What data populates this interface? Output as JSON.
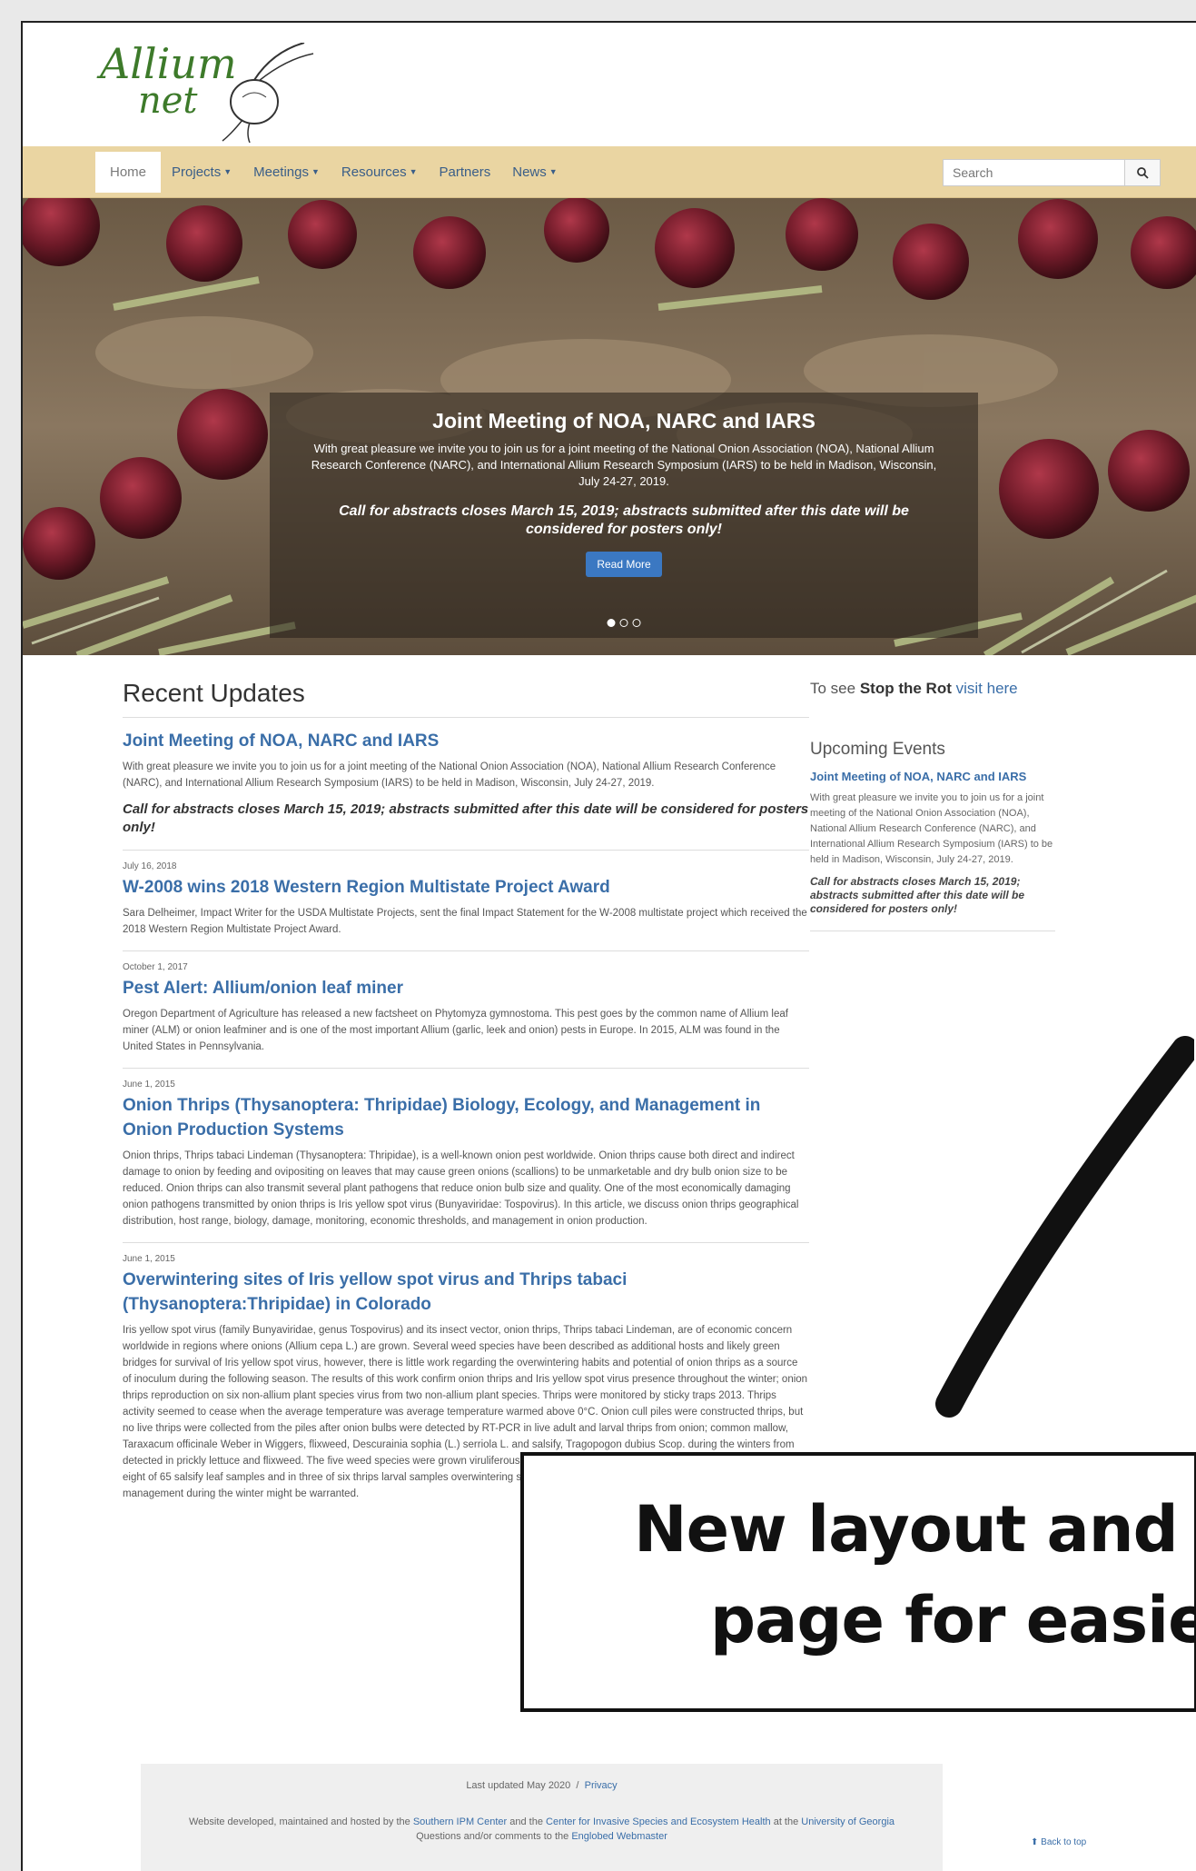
{
  "logo": {
    "line1": "Allium",
    "line2": "net"
  },
  "nav": {
    "items": [
      {
        "label": "Home"
      },
      {
        "label": "Projects"
      },
      {
        "label": "Meetings"
      },
      {
        "label": "Resources"
      },
      {
        "label": "Partners"
      },
      {
        "label": "News"
      }
    ],
    "search_placeholder": "Search"
  },
  "hero": {
    "title": "Joint Meeting of NOA, NARC and IARS",
    "text": "With great pleasure we invite you to join us for a joint meeting of the National Onion Association (NOA), National Allium Research Conference (NARC), and International Allium Research Symposium (IARS) to be held in Madison, Wisconsin, July 24-27, 2019.",
    "cta": "Call for abstracts closes March 15, 2019; abstracts submitted after this date will be considered for posters only!",
    "button": "Read More"
  },
  "recent": {
    "heading": "Recent Updates",
    "posts": [
      {
        "date": "",
        "title": "Joint Meeting of NOA, NARC and IARS",
        "body": "With great pleasure we invite you to join us for a joint meeting of the National Onion Association (NOA), National Allium Research Conference (NARC), and International Allium Research Symposium (IARS) to be held in Madison, Wisconsin, July 24-27, 2019.",
        "cta": "Call for abstracts closes March 15, 2019; abstracts submitted after this date will be considered for posters only!"
      },
      {
        "date": "July 16, 2018",
        "title": "W-2008 wins 2018 Western Region Multistate Project Award",
        "body": "Sara Delheimer, Impact Writer for the USDA Multistate Projects, sent the final Impact Statement for the W-2008 multistate project which received the 2018 Western Region Multistate Project Award.",
        "cta": ""
      },
      {
        "date": "October 1, 2017",
        "title": "Pest Alert: Allium/onion leaf miner",
        "body": "Oregon Department of Agriculture has released a new factsheet on Phytomyza gymnostoma. This pest goes by the common name of Allium leaf miner (ALM) or onion leafminer and is one of the most important Allium (garlic, leek and onion) pests in Europe. In 2015, ALM was found in the United States in Pennsylvania.",
        "cta": ""
      },
      {
        "date": "June 1, 2015",
        "title": "Onion Thrips (Thysanoptera: Thripidae) Biology, Ecology, and Management in Onion Production Systems",
        "body": "Onion thrips, Thrips tabaci Lindeman (Thysanoptera: Thripidae), is a well-known onion pest worldwide. Onion thrips cause both direct and indirect damage to onion by feeding and ovipositing on leaves that may cause green onions (scallions) to be unmarketable and dry bulb onion size to be reduced. Onion thrips can also transmit several plant pathogens that reduce onion bulb size and quality. One of the most economically damaging onion pathogens transmitted by onion thrips is Iris yellow spot virus (Bunyaviridae: Tospovirus). In this article, we discuss onion thrips geographical distribution, host range, biology, damage, monitoring, economic thresholds, and management in onion production.",
        "cta": ""
      },
      {
        "date": "June 1, 2015",
        "title": "Overwintering sites of Iris yellow spot virus and Thrips tabaci (Thysanoptera:Thripidae) in Colorado",
        "body": "Iris yellow spot virus (family Bunyaviridae, genus Tospovirus) and its insect vector, onion thrips, Thrips tabaci Lindeman, are of economic concern worldwide in regions where onions (Allium cepa L.) are grown. Several weed species have been described as additional hosts and likely green bridges for survival of Iris yellow spot virus, however, there is little work regarding the overwintering habits and potential of onion thrips as a source of inoculum during the following season. The results of this work confirm onion thrips and Iris yellow spot virus presence throughout the winter; onion thrips reproduction on six non-allium plant species virus from two non-allium plant species. Thrips were monitored by sticky traps 2013. Thrips activity seemed to cease when the average temperature was average temperature warmed above 0°C. Onion cull piles were constructed thrips, but no live thrips were collected from the piles after onion bulbs were detected by RT-PCR in live adult and larval thrips from onion; common mallow, Taraxacum officinale Weber in Wiggers, flixweed, Descurainia sophia (L.) serriola L. and salsify, Tragopogon dubius Scop. during the winters from detected in prickly lettuce and flixweed. The five weed species were grown viruliferous thrips to elucidate their potential as green bridges. Of the five eight of 65 salsify leaf samples and in three of six thrips larval samples overwintering survival of onion thrips and Iris yellow spot virus, providing management during the winter might be warranted.",
        "cta": ""
      }
    ]
  },
  "sidebar": {
    "stoprot_prefix": "To see",
    "stoprot_bold": "Stop the Rot",
    "stoprot_link": "visit here",
    "events_heading": "Upcoming Events",
    "event_title": "Joint Meeting of NOA, NARC and IARS",
    "event_body": "With great pleasure we invite you to join us for a joint meeting of the National Onion Association (NOA), National Allium Research Conference (NARC), and International Allium Research Symposium (IARS) to be held in Madison, Wisconsin, July 24-27, 2019.",
    "event_cta": "Call for abstracts closes March 15, 2019; abstracts submitted after this date will be considered for posters only!"
  },
  "footer": {
    "updated": "Last updated May 2020",
    "sep": "/",
    "privacy": "Privacy",
    "credit_prefix": "Website developed, maintained and hosted by the",
    "credit_link1": "Southern IPM Center",
    "credit_mid": "and the",
    "credit_link2": "Center for Invasive Species and Ecosystem Health",
    "credit_mid2": "at the",
    "credit_link3": "University of Georgia",
    "credit_line2_prefix": "Questions and/or comments to the",
    "credit_link4": "Englobed Webmaster",
    "back_to_top": "Back to top"
  },
  "overlay": {
    "line1": "New layout and u",
    "line2": "page for easier"
  },
  "colors": {
    "navbar": "#ead5a2",
    "link": "#3a6ea8",
    "button": "#3b78c2"
  }
}
